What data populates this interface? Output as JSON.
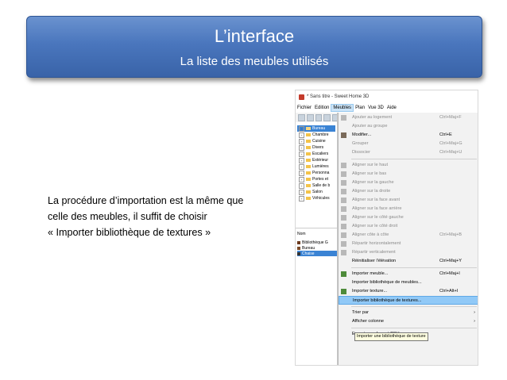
{
  "header": {
    "title": "L’interface",
    "subtitle": "La liste des meubles utilisés"
  },
  "body_text": [
    "La procédure d’importation est la même que",
    "celle des meubles, il suffit de choisir",
    "« Importer bibliothèque de textures »"
  ],
  "screenshot": {
    "window_title": "* Sans titre - Sweet Home 3D",
    "menubar": [
      "Fichier",
      "Edition",
      "Meubles",
      "Plan",
      "Vue 3D",
      "Aide"
    ],
    "active_menu": "Meubles",
    "tree": [
      {
        "label": "Bureau",
        "selected": true
      },
      {
        "label": "Chambre",
        "selected": false
      },
      {
        "label": "Cuisine",
        "selected": false
      },
      {
        "label": "Divers",
        "selected": false
      },
      {
        "label": "Escaliers",
        "selected": false
      },
      {
        "label": "Extérieur",
        "selected": false
      },
      {
        "label": "Lumières",
        "selected": false
      },
      {
        "label": "Personna",
        "selected": false
      },
      {
        "label": "Portes et",
        "selected": false
      },
      {
        "label": "Salle de b",
        "selected": false
      },
      {
        "label": "Salon",
        "selected": false
      },
      {
        "label": "Véhicules",
        "selected": false
      }
    ],
    "furniture_list": {
      "column_header": "Nom",
      "rows": [
        {
          "label": "Bibliothèque G",
          "selected": false,
          "color": "#6b3a1e"
        },
        {
          "label": "Bureau",
          "selected": false,
          "color": "#7a4a28"
        },
        {
          "label": "Chaise",
          "selected": true,
          "color": "#333333"
        }
      ]
    },
    "menu_items": [
      {
        "label": "Ajouter au logement",
        "shortcut": "Ctrl+Maj+F",
        "disabled": true,
        "icon": "add-furniture-icon"
      },
      {
        "label": "Ajouter au groupe",
        "shortcut": "",
        "disabled": true,
        "icon": ""
      },
      {
        "label": "Modifier...",
        "shortcut": "Ctrl+E",
        "disabled": false,
        "icon": "modify-icon"
      },
      {
        "label": "Grouper",
        "shortcut": "Ctrl+Maj+G",
        "disabled": true,
        "icon": ""
      },
      {
        "label": "Dissocier",
        "shortcut": "Ctrl+Maj+U",
        "disabled": true,
        "icon": ""
      },
      {
        "sep": true
      },
      {
        "label": "Aligner sur le haut",
        "shortcut": "",
        "disabled": true,
        "icon": "align-top-icon"
      },
      {
        "label": "Aligner sur le bas",
        "shortcut": "",
        "disabled": true,
        "icon": "align-bottom-icon"
      },
      {
        "label": "Aligner sur la gauche",
        "shortcut": "",
        "disabled": true,
        "icon": "align-left-icon"
      },
      {
        "label": "Aligner sur la droite",
        "shortcut": "",
        "disabled": true,
        "icon": "align-right-icon"
      },
      {
        "label": "Aligner sur la face avant",
        "shortcut": "",
        "disabled": true,
        "icon": "align-front-icon"
      },
      {
        "label": "Aligner sur la face arrière",
        "shortcut": "",
        "disabled": true,
        "icon": "align-back-icon"
      },
      {
        "label": "Aligner sur le côté gauche",
        "shortcut": "",
        "disabled": true,
        "icon": "align-left-side-icon"
      },
      {
        "label": "Aligner sur le côté droit",
        "shortcut": "",
        "disabled": true,
        "icon": "align-right-side-icon"
      },
      {
        "label": "Aligner côte à côte",
        "shortcut": "Ctrl+Maj+B",
        "disabled": true,
        "icon": "align-side-by-side-icon"
      },
      {
        "label": "Répartir horizontalement",
        "shortcut": "",
        "disabled": true,
        "icon": "distribute-h-icon"
      },
      {
        "label": "Répartir verticalement",
        "shortcut": "",
        "disabled": true,
        "icon": "distribute-v-icon"
      },
      {
        "label": "Réinitialiser l'élévation",
        "shortcut": "Ctrl+Maj+Y",
        "disabled": false,
        "icon": ""
      },
      {
        "sep": true
      },
      {
        "label": "Importer meuble...",
        "shortcut": "Ctrl+Maj+I",
        "disabled": false,
        "icon": "import-furniture-icon"
      },
      {
        "label": "Importer bibliothèque de meubles...",
        "shortcut": "",
        "disabled": false,
        "icon": ""
      },
      {
        "label": "Importer texture...",
        "shortcut": "Ctrl+Alt+I",
        "disabled": false,
        "icon": "import-texture-icon"
      },
      {
        "label": "Importer bibliothèque de textures...",
        "shortcut": "",
        "disabled": false,
        "icon": "",
        "highlighted": true
      },
      {
        "sep": true
      },
      {
        "label": "Trier par",
        "shortcut": "",
        "disabled": false,
        "icon": "",
        "submenu": true
      },
      {
        "label": "Afficher colonne",
        "shortcut": "",
        "disabled": false,
        "icon": "",
        "submenu": true
      },
      {
        "sep": true
      },
      {
        "label": "Exporter au format CSV...",
        "shortcut": "",
        "disabled": false,
        "icon": ""
      }
    ],
    "tooltip": "Importer une bibliothèque de texture",
    "submenu_arrow": "›"
  },
  "colors": {
    "banner_top": "#6a92cf",
    "banner_bottom": "#3963a8",
    "highlight": "#91c9f7",
    "selection": "#3a83d4"
  }
}
